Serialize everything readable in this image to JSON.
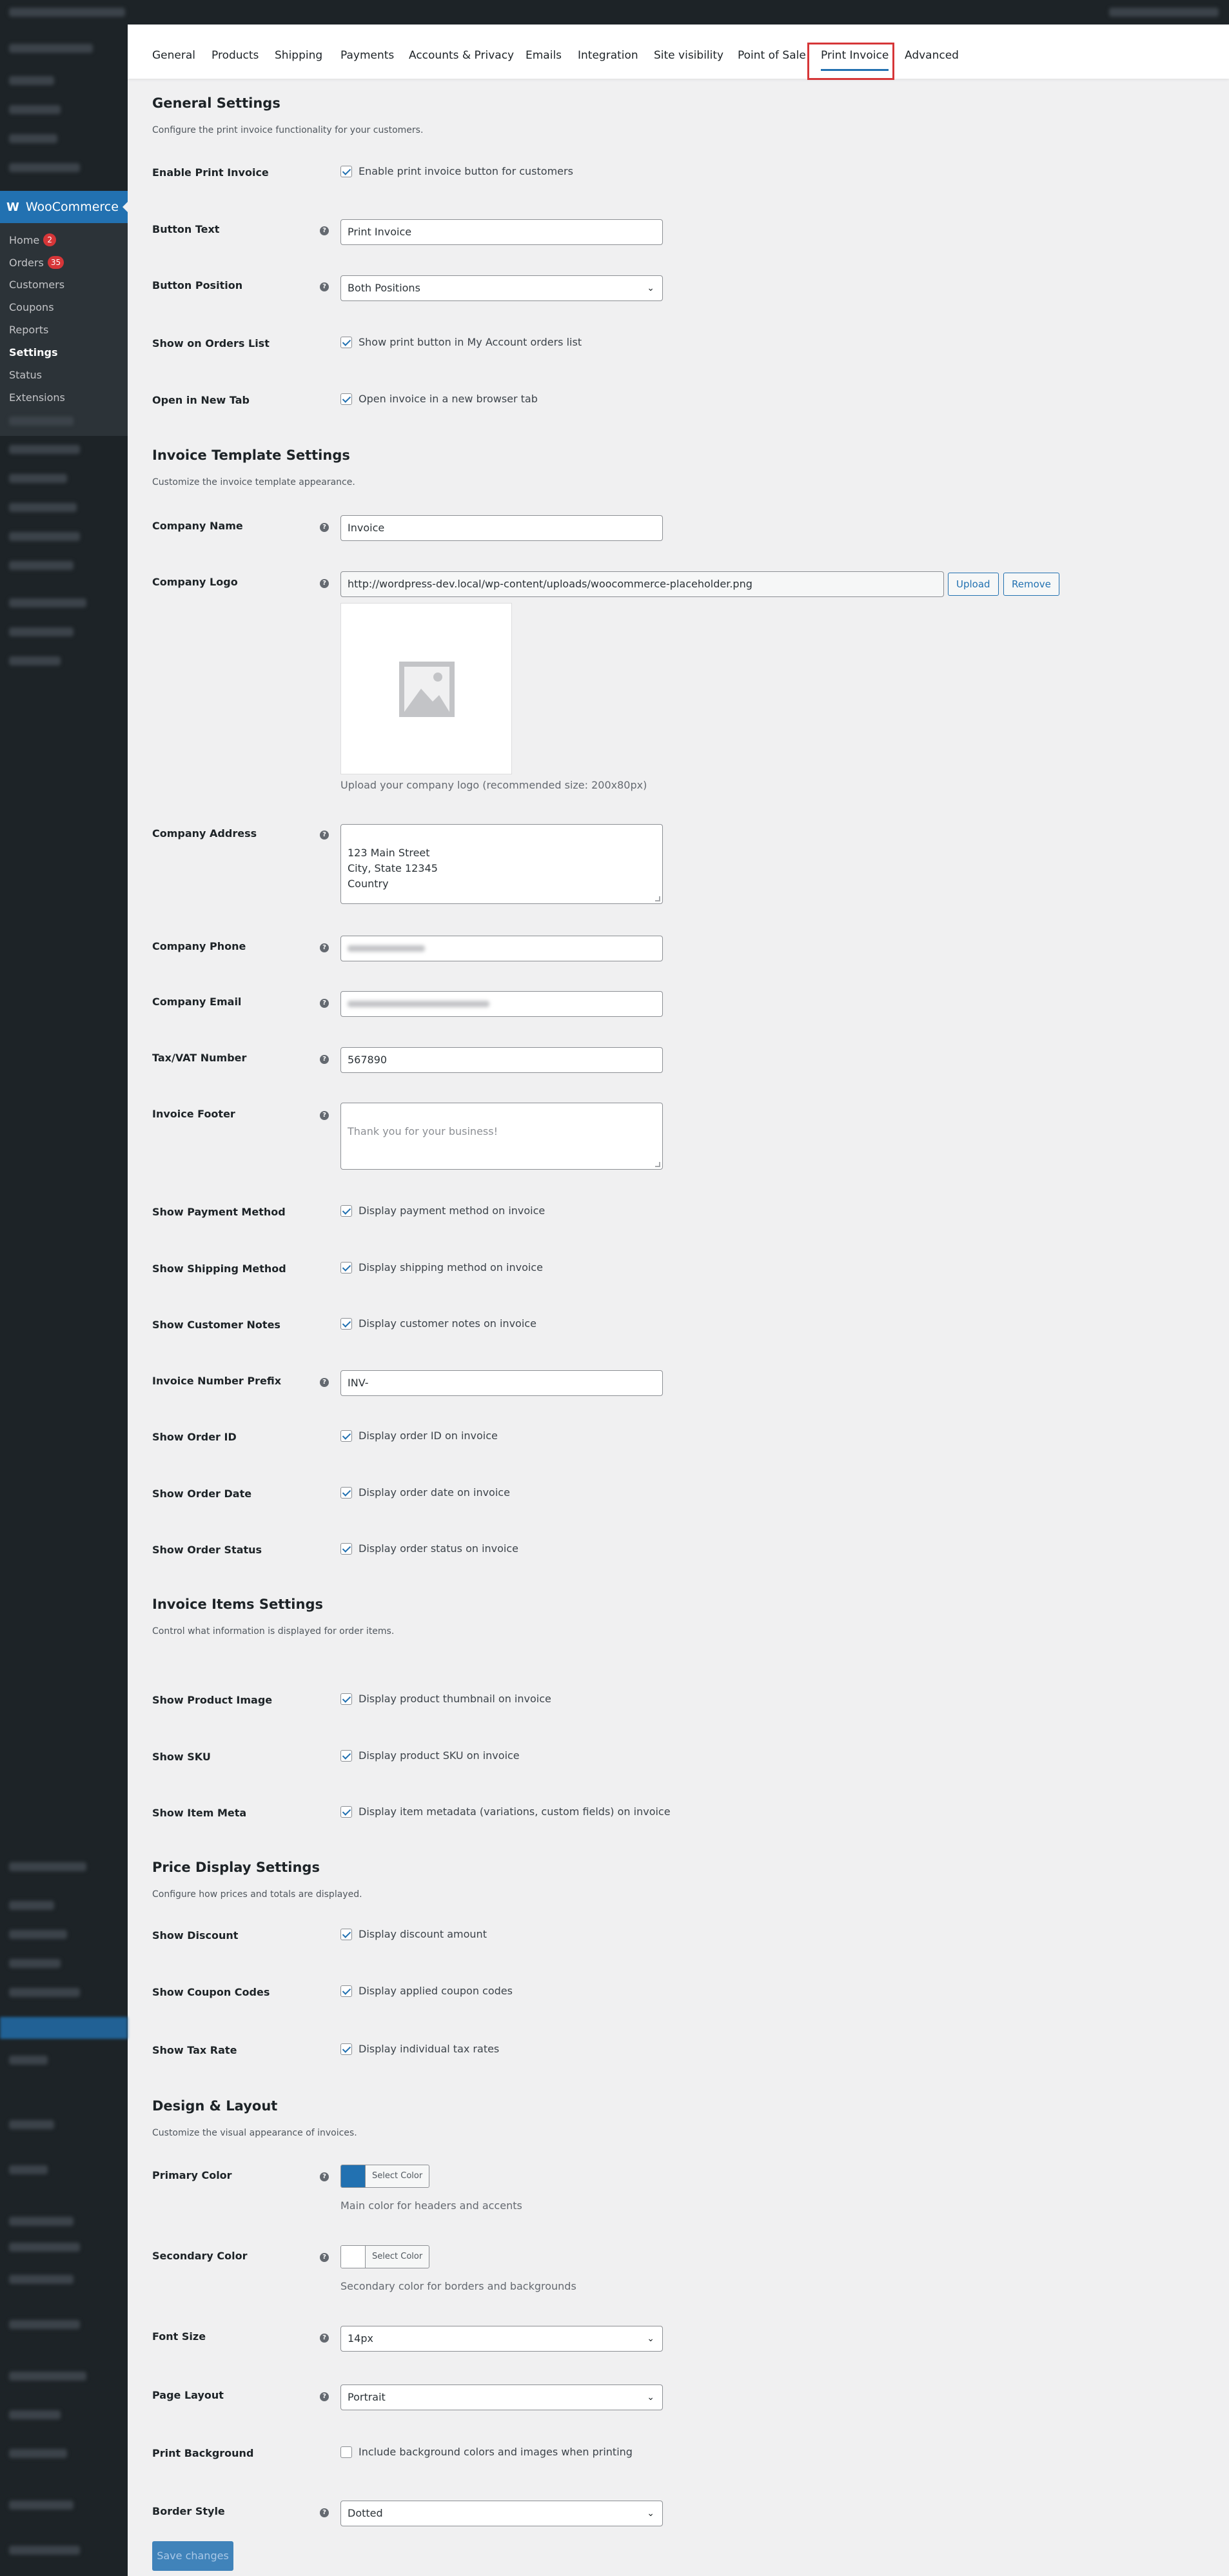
{
  "tabs": [
    "General",
    "Products",
    "Shipping",
    "Payments",
    "Accounts & Privacy",
    "Emails",
    "Integration",
    "Site visibility",
    "Point of Sale",
    "Print Invoice",
    "Advanced"
  ],
  "sidebar": {
    "menu_title": "WooCommerce",
    "items": [
      {
        "label": "Home",
        "badge": "2"
      },
      {
        "label": "Orders",
        "badge": "35"
      },
      {
        "label": "Customers"
      },
      {
        "label": "Coupons"
      },
      {
        "label": "Reports"
      },
      {
        "label": "Settings"
      },
      {
        "label": "Status"
      },
      {
        "label": "Extensions"
      }
    ]
  },
  "general": {
    "title": "General Settings",
    "desc": "Configure the print invoice functionality for your customers.",
    "enable_label": "Enable Print Invoice",
    "enable_cb": "Enable print invoice button for customers",
    "button_text_label": "Button Text",
    "button_text_value": "Print Invoice",
    "button_position_label": "Button Position",
    "button_position_value": "Both Positions",
    "orders_list_label": "Show on Orders List",
    "orders_list_cb": "Show print button in My Account orders list",
    "new_tab_label": "Open in New Tab",
    "new_tab_cb": "Open invoice in a new browser tab"
  },
  "template": {
    "title": "Invoice Template Settings",
    "desc": "Customize the invoice template appearance.",
    "company_name_label": "Company Name",
    "company_name_value": "Invoice",
    "company_logo_label": "Company Logo",
    "company_logo_value": "http://wordpress-dev.local/wp-content/uploads/woocommerce-placeholder.png",
    "upload_btn": "Upload",
    "remove_btn": "Remove",
    "logo_hint": "Upload your company logo (recommended size: 200x80px)",
    "company_address_label": "Company Address",
    "company_address_value": "123 Main Street\nCity, State 12345\nCountry",
    "company_phone_label": "Company Phone",
    "company_email_label": "Company Email",
    "tax_label": "Tax/VAT Number",
    "tax_value": "567890",
    "footer_label": "Invoice Footer",
    "footer_placeholder": "Thank you for your business!",
    "payment_label": "Show Payment Method",
    "payment_cb": "Display payment method on invoice",
    "shipping_label": "Show Shipping Method",
    "shipping_cb": "Display shipping method on invoice",
    "notes_label": "Show Customer Notes",
    "notes_cb": "Display customer notes on invoice",
    "prefix_label": "Invoice Number Prefix",
    "prefix_value": "INV-",
    "order_id_label": "Show Order ID",
    "order_id_cb": "Display order ID on invoice",
    "order_date_label": "Show Order Date",
    "order_date_cb": "Display order date on invoice",
    "order_status_label": "Show Order Status",
    "order_status_cb": "Display order status on invoice"
  },
  "items": {
    "title": "Invoice Items Settings",
    "desc": "Control what information is displayed for order items.",
    "image_label": "Show Product Image",
    "image_cb": "Display product thumbnail on invoice",
    "sku_label": "Show SKU",
    "sku_cb": "Display product SKU on invoice",
    "meta_label": "Show Item Meta",
    "meta_cb": "Display item metadata (variations, custom fields) on invoice"
  },
  "price": {
    "title": "Price Display Settings",
    "desc": "Configure how prices and totals are displayed.",
    "discount_label": "Show Discount",
    "discount_cb": "Display discount amount",
    "coupon_label": "Show Coupon Codes",
    "coupon_cb": "Display applied coupon codes",
    "tax_rate_label": "Show Tax Rate",
    "tax_rate_cb": "Display individual tax rates"
  },
  "design": {
    "title": "Design & Layout",
    "desc": "Customize the visual appearance of invoices.",
    "primary_label": "Primary Color",
    "primary_color": "#2271b1",
    "primary_hint": "Main color for headers and accents",
    "secondary_label": "Secondary Color",
    "secondary_color": "#ffffff",
    "secondary_hint": "Secondary color for borders and backgrounds",
    "select_color": "Select Color",
    "font_size_label": "Font Size",
    "font_size_value": "14px",
    "page_layout_label": "Page Layout",
    "page_layout_value": "Portrait",
    "print_bg_label": "Print Background",
    "print_bg_cb": "Include background colors and images when printing",
    "border_label": "Border Style",
    "border_value": "Dotted"
  },
  "save_button": "Save changes"
}
